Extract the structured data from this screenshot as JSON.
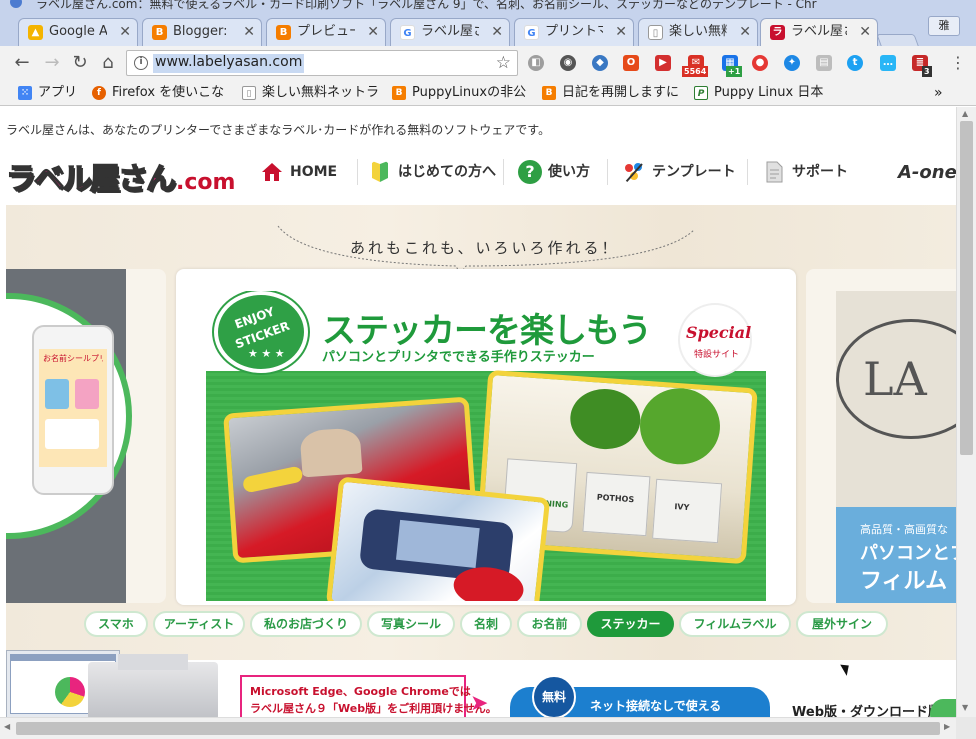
{
  "window": {
    "title": "ラベル屋さん.com：無料で使えるラベル・カード印刷ソフト「ラベル屋さん 9」で、名刺、お名前シール、ステッカーなどのテンプレート - Chr"
  },
  "tabs": [
    {
      "label": "Google A",
      "icon": "google-drive-icon",
      "color": "#f4b400"
    },
    {
      "label": "Blogger: l",
      "icon": "blogger-icon",
      "color": "#f57d00"
    },
    {
      "label": "プレビュー",
      "icon": "blogger-icon",
      "color": "#f57d00"
    },
    {
      "label": "ラベル屋さ",
      "icon": "google-icon",
      "color": "#4285f4"
    },
    {
      "label": "プリントマ",
      "icon": "google-icon",
      "color": "#4285f4"
    },
    {
      "label": "楽しい無料",
      "icon": "page-icon",
      "color": "#888888"
    },
    {
      "label": "ラベル屋さ",
      "icon": "labelyasan-icon",
      "color": "#c8102e"
    }
  ],
  "user_button": "雅",
  "toolbar": {
    "url": "www.labelyasan.com",
    "extensions": [
      {
        "icon": "extension-icon",
        "color": "#9e9e9e"
      },
      {
        "icon": "globe-icon",
        "color": "#555555"
      },
      {
        "icon": "shield-icon",
        "color": "#3a78c3"
      },
      {
        "icon": "office-icon",
        "color": "#e64a19"
      },
      {
        "icon": "media-icon",
        "color": "#d32f2f"
      },
      {
        "icon": "gmail-icon",
        "color": "#d93025",
        "badge": "5564"
      },
      {
        "icon": "calendar-icon",
        "color": "#1a73e8",
        "badge": "+1"
      },
      {
        "icon": "camera-icon",
        "color": "#e53935"
      },
      {
        "icon": "compass-icon",
        "color": "#1e88e5"
      },
      {
        "icon": "doc-icon",
        "color": "#9e9e9e"
      },
      {
        "icon": "twitter-icon",
        "color": "#1da1f2"
      },
      {
        "icon": "chat-icon",
        "color": "#29b6f6"
      },
      {
        "icon": "stack-icon",
        "color": "#c62828",
        "badge": "3"
      }
    ]
  },
  "bookmarks": [
    {
      "label": "アプリ",
      "icon": "apps-icon",
      "color": "#4285f4"
    },
    {
      "label": "Firefox を使いこな",
      "icon": "firefox-icon",
      "color": "#e66000"
    },
    {
      "label": "楽しい無料ネットラ",
      "icon": "page-icon",
      "color": "#888888"
    },
    {
      "label": "PuppyLinuxの非公",
      "icon": "blogger-icon",
      "color": "#f57d00"
    },
    {
      "label": "日記を再開しますに",
      "icon": "blogger-icon",
      "color": "#f57d00"
    },
    {
      "label": "Puppy Linux 日本",
      "icon": "puppy-icon",
      "color": "#2e7d32"
    }
  ],
  "page": {
    "intro": "ラベル屋さんは、あなたのプリンターでさまざまなラベル･カードが作れる無料のソフトウェアです。",
    "logo": {
      "main": "ラベル屋さん",
      "domain": ".com"
    },
    "nav": [
      {
        "label": "HOME",
        "icon": "home-icon",
        "color": "#c8102e"
      },
      {
        "label": "はじめての方へ",
        "icon": "beginner-mark-icon",
        "color": "#8bc34a"
      },
      {
        "label": "使い方",
        "icon": "question-icon",
        "color": "#2e9f44"
      },
      {
        "label": "テンプレート",
        "icon": "palette-icon",
        "color": "#e53935"
      },
      {
        "label": "サポート",
        "icon": "support-doc-icon",
        "color": "#9e9e9e"
      }
    ],
    "aone": "A-one",
    "tagline": "あれもこれも、いろいろ作れる！",
    "left_card": {
      "text": "お名前シールプリント"
    },
    "banner": {
      "title": "ステッカーを楽しもう",
      "subtitle": "パソコンとプリンタでできる手作りステッカー",
      "enjoy1": "ENJOY",
      "enjoy2": "STICKER",
      "special": "Special",
      "special_sub": "特設サイト",
      "pot_labels": [
        "GARDENING",
        "POTHOS",
        "IVY"
      ]
    },
    "right_card": {
      "t1": "高品質・高画質な",
      "t2": "パソコンとプ",
      "t3": "フィルム",
      "oval": "LA"
    },
    "categories": [
      {
        "label": "スマホ",
        "active": false
      },
      {
        "label": "アーティスト",
        "active": false
      },
      {
        "label": "私のお店づくり",
        "active": false
      },
      {
        "label": "写真シール",
        "active": false
      },
      {
        "label": "名刺",
        "active": false
      },
      {
        "label": "お名前",
        "active": false
      },
      {
        "label": "ステッカー",
        "active": true
      },
      {
        "label": "フィルムラベル",
        "active": false
      },
      {
        "label": "屋外サイン",
        "active": false
      }
    ],
    "bottom": {
      "warn1": "Microsoft Edge、Google Chromeでは",
      "warn2": "ラベル屋さん９「Web版」をご利用頂けません。",
      "free_badge": "無料",
      "free_text": "ネット接続なしで使える",
      "webdl": "Web版・ダウンロード版"
    }
  }
}
